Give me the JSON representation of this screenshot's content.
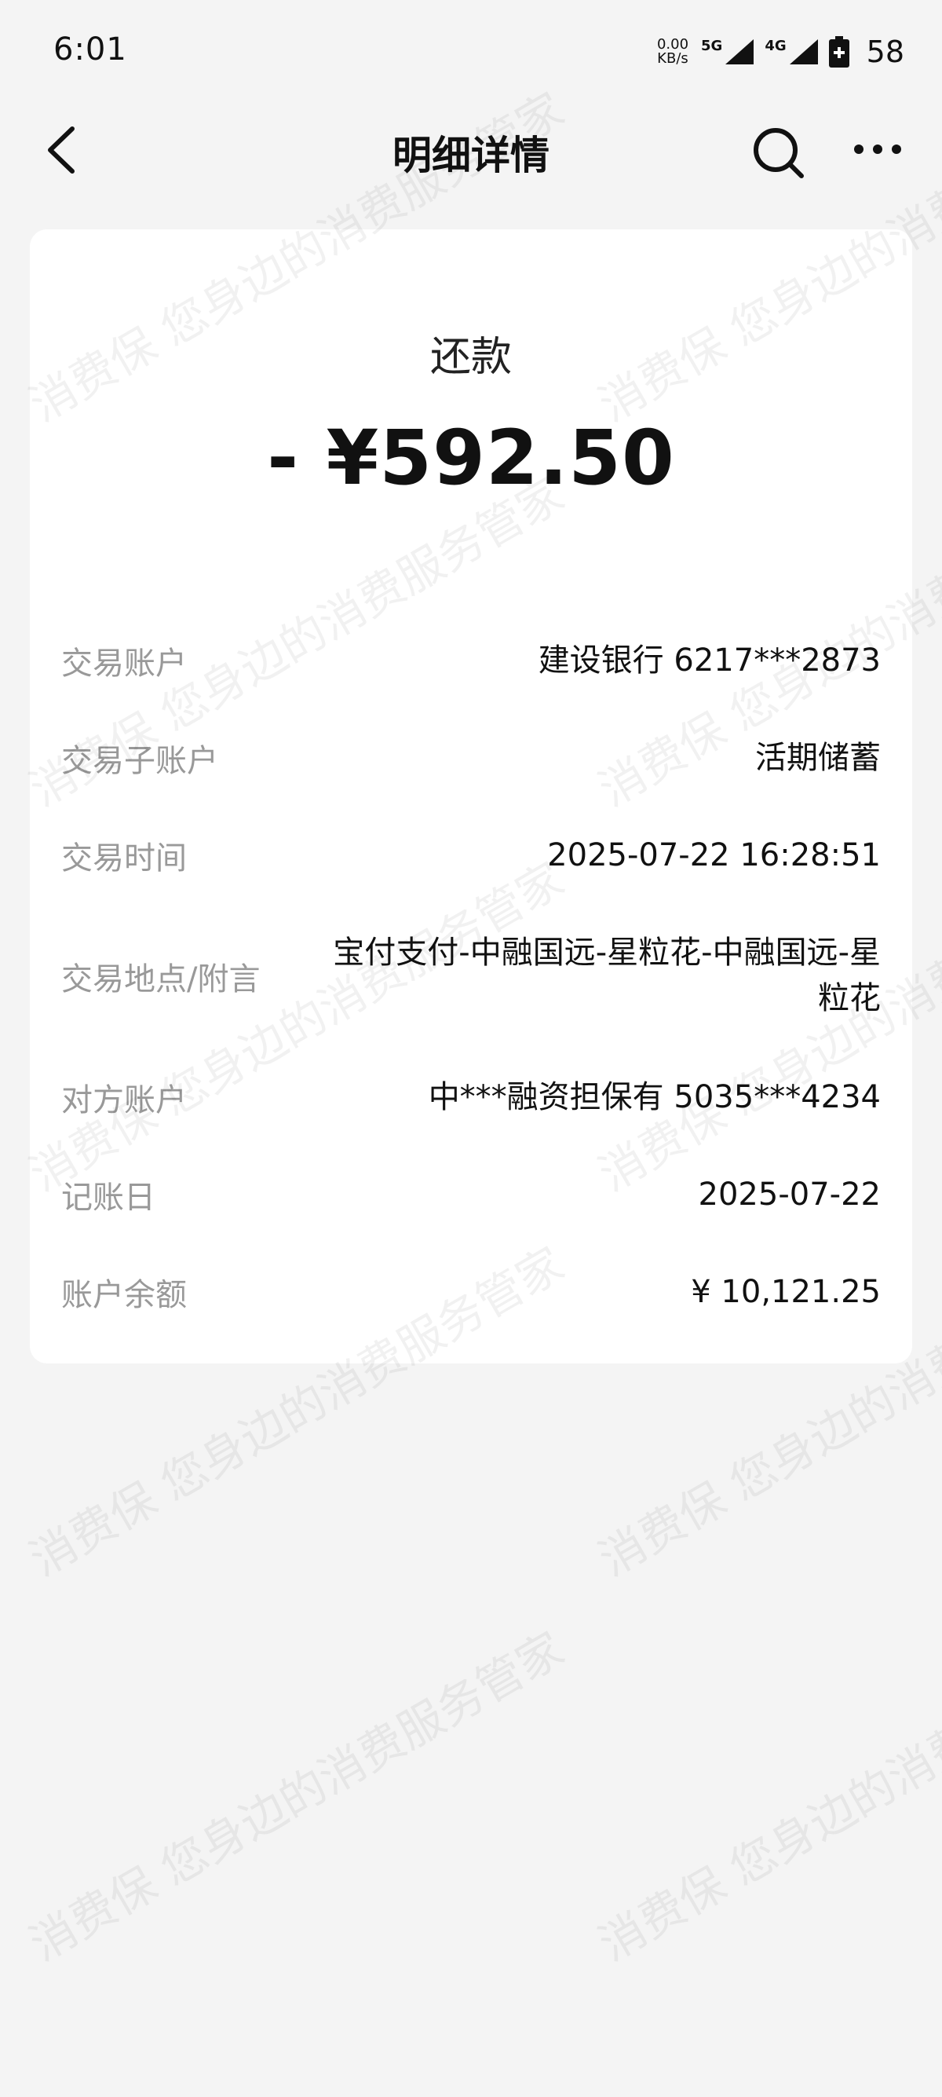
{
  "status_bar": {
    "time": "6:01",
    "net_speed_value": "0.00",
    "net_speed_unit": "KB/s",
    "signal_1_label": "5G",
    "signal_2_label": "4G",
    "battery_level": "58"
  },
  "nav": {
    "title": "明细详情",
    "back_icon": "chevron-left-icon",
    "search_icon": "search-icon",
    "more_icon": "more-dots-icon"
  },
  "transaction": {
    "type": "还款",
    "amount": "- ¥592.50"
  },
  "details": [
    {
      "label": "交易账户",
      "value": "建设银行 6217***2873"
    },
    {
      "label": "交易子账户",
      "value": "活期储蓄"
    },
    {
      "label": "交易时间",
      "value": "2025-07-22 16:28:51"
    },
    {
      "label": "交易地点/附言",
      "value": "宝付支付-中融国远-星粒花-中融国远-星粒花"
    },
    {
      "label": "对方账户",
      "value": "中***融资担保有 5035***4234"
    },
    {
      "label": "记账日",
      "value": "2025-07-22"
    },
    {
      "label": "账户余额",
      "value": "¥ 10,121.25"
    }
  ],
  "watermark": {
    "text": "消费保 您身边的消费服务管家"
  }
}
